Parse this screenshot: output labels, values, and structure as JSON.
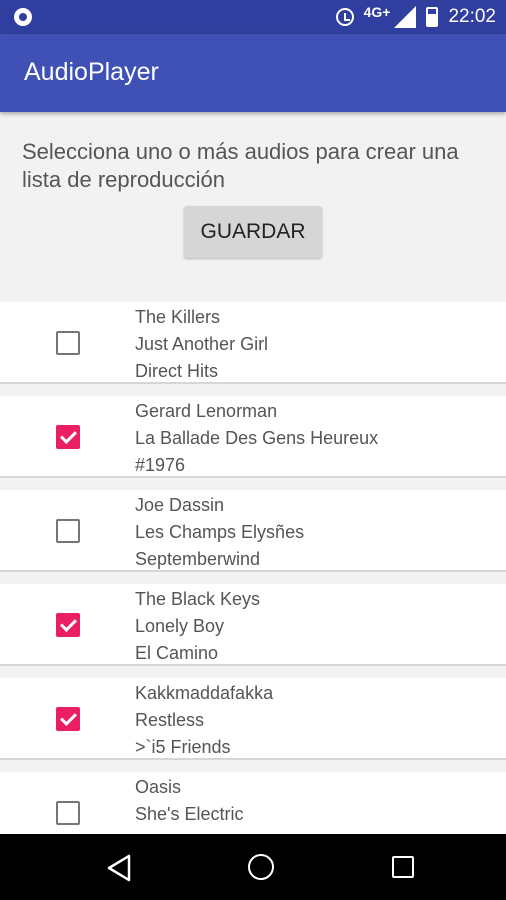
{
  "status_bar": {
    "network": "4G+",
    "time": "22:02"
  },
  "app_bar": {
    "title": "AudioPlayer"
  },
  "intro": {
    "text": "Selecciona uno o más audios para crear una lista de reproducción"
  },
  "save_button": {
    "label": "GUARDAR"
  },
  "songs": [
    {
      "artist": "The Killers",
      "title": "Just Another Girl",
      "album": "Direct Hits",
      "checked": false
    },
    {
      "artist": "Gerard Lenorman",
      "title": "La Ballade Des Gens Heureux",
      "album": "#1976",
      "checked": true
    },
    {
      "artist": "Joe Dassin",
      "title": "Les Champs Elysñes",
      "album": "Septemberwind",
      "checked": false
    },
    {
      "artist": "The Black Keys",
      "title": "Lonely Boy",
      "album": "El Camino",
      "checked": true
    },
    {
      "artist": "Kakkmaddafakka",
      "title": "Restless",
      "album": ">`i5 Friends",
      "checked": true
    },
    {
      "artist": "Oasis",
      "title": "She's Electric",
      "album": "",
      "checked": false
    }
  ],
  "colors": {
    "primary": "#3f51b5",
    "primary_dark": "#303f9f",
    "accent": "#e91e63"
  }
}
